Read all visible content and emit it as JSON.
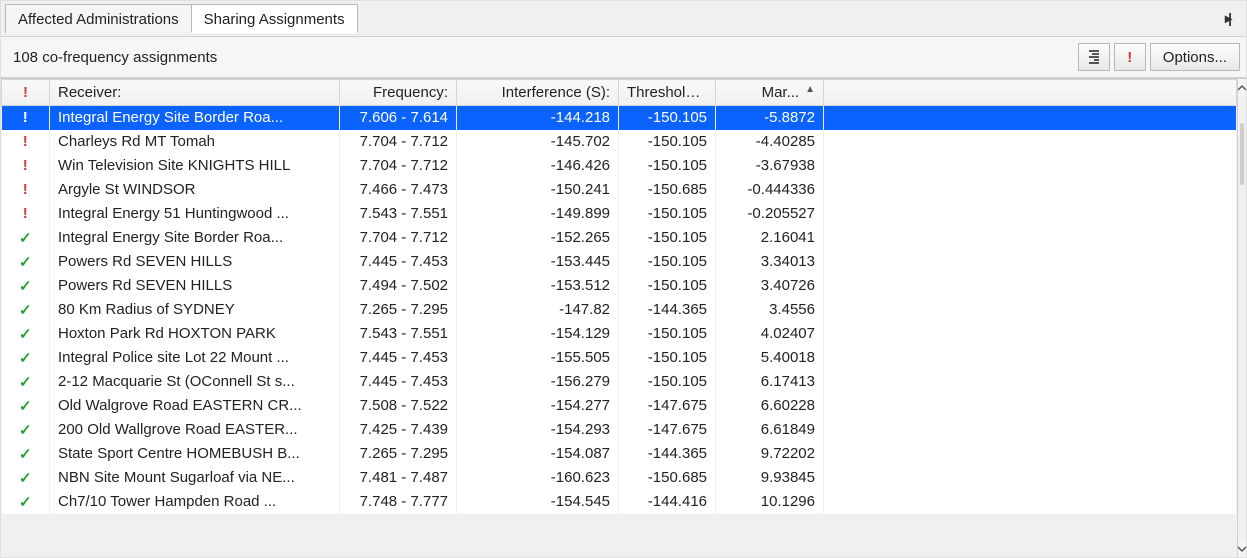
{
  "tabs": [
    {
      "label": "Affected Administrations"
    },
    {
      "label": "Sharing Assignments"
    }
  ],
  "active_tab": 1,
  "status_text": "108 co-frequency assignments",
  "toolbar": {
    "align_tooltip": "Align",
    "filter_tooltip": "!",
    "options_label": "Options..."
  },
  "columns": {
    "status": "!",
    "receiver": "Receiver:",
    "frequency": "Frequency:",
    "interference": "Interference (S):",
    "threshold": "Threshold (S):",
    "margin": "Mar..."
  },
  "sort": {
    "column": "margin",
    "dir": "asc"
  },
  "rows": [
    {
      "status": "err-mid",
      "receiver": "Integral Energy Site  Border Roa...",
      "frequency": "7.606 - 7.614",
      "interference": "-144.218",
      "threshold": "-150.105",
      "margin": "-5.8872",
      "selected": true
    },
    {
      "status": "err",
      "receiver": "Charleys Rd MT Tomah",
      "frequency": "7.704 - 7.712",
      "interference": "-145.702",
      "threshold": "-150.105",
      "margin": "-4.40285"
    },
    {
      "status": "err",
      "receiver": "Win Television Site  KNIGHTS HILL",
      "frequency": "7.704 - 7.712",
      "interference": "-146.426",
      "threshold": "-150.105",
      "margin": "-3.67938"
    },
    {
      "status": "err",
      "receiver": "Argyle St WINDSOR",
      "frequency": "7.466 - 7.473",
      "interference": "-150.241",
      "threshold": "-150.685",
      "margin": "-0.444336"
    },
    {
      "status": "err",
      "receiver": "Integral Energy 51 Huntingwood ...",
      "frequency": "7.543 - 7.551",
      "interference": "-149.899",
      "threshold": "-150.105",
      "margin": "-0.205527"
    },
    {
      "status": "ok",
      "receiver": "Integral Energy Site  Border Roa...",
      "frequency": "7.704 - 7.712",
      "interference": "-152.265",
      "threshold": "-150.105",
      "margin": "2.16041"
    },
    {
      "status": "ok",
      "receiver": "Powers Rd SEVEN HILLS",
      "frequency": "7.445 - 7.453",
      "interference": "-153.445",
      "threshold": "-150.105",
      "margin": "3.34013"
    },
    {
      "status": "ok",
      "receiver": "Powers Rd SEVEN HILLS",
      "frequency": "7.494 - 7.502",
      "interference": "-153.512",
      "threshold": "-150.105",
      "margin": "3.40726"
    },
    {
      "status": "ok",
      "receiver": "80 Km Radius of SYDNEY",
      "frequency": "7.265 - 7.295",
      "interference": "-147.82",
      "threshold": "-144.365",
      "margin": "3.4556"
    },
    {
      "status": "ok",
      "receiver": "Hoxton Park Rd HOXTON PARK",
      "frequency": "7.543 - 7.551",
      "interference": "-154.129",
      "threshold": "-150.105",
      "margin": "4.02407"
    },
    {
      "status": "ok",
      "receiver": "Integral Police site Lot 22 Mount ...",
      "frequency": "7.445 - 7.453",
      "interference": "-155.505",
      "threshold": "-150.105",
      "margin": "5.40018"
    },
    {
      "status": "ok",
      "receiver": "2-12 Macquarie St (OConnell St s...",
      "frequency": "7.445 - 7.453",
      "interference": "-156.279",
      "threshold": "-150.105",
      "margin": "6.17413"
    },
    {
      "status": "ok",
      "receiver": "Old Walgrove Road EASTERN CR...",
      "frequency": "7.508 - 7.522",
      "interference": "-154.277",
      "threshold": "-147.675",
      "margin": "6.60228"
    },
    {
      "status": "ok",
      "receiver": "200 Old Wallgrove Road EASTER...",
      "frequency": "7.425 - 7.439",
      "interference": "-154.293",
      "threshold": "-147.675",
      "margin": "6.61849"
    },
    {
      "status": "ok",
      "receiver": "State Sport Centre HOMEBUSH B...",
      "frequency": "7.265 - 7.295",
      "interference": "-154.087",
      "threshold": "-144.365",
      "margin": "9.72202"
    },
    {
      "status": "ok",
      "receiver": "NBN Site Mount Sugarloaf via NE...",
      "frequency": "7.481 - 7.487",
      "interference": "-160.623",
      "threshold": "-150.685",
      "margin": "9.93845"
    },
    {
      "status": "ok",
      "receiver": "Ch7/10 Tower  Hampden Road  ...",
      "frequency": "7.748 - 7.777",
      "interference": "-154.545",
      "threshold": "-144.416",
      "margin": "10.1296"
    }
  ]
}
